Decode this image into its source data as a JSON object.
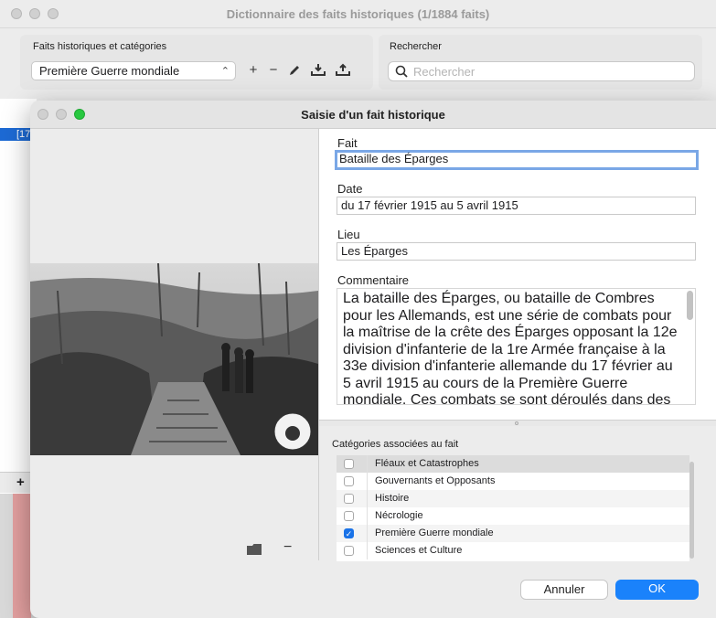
{
  "back_window": {
    "title": "Dictionnaire des faits historiques (1/1884 faits)",
    "group_label": "Faits historiques et catégories",
    "selected_category": "Première Guerre mondiale",
    "search_label": "Rechercher",
    "search_placeholder": "Rechercher",
    "list_fragment": "[17",
    "add_symbol": "+"
  },
  "dialog": {
    "title": "Saisie d'un fait historique",
    "fait_label": "Fait",
    "fait_value": "Bataille des Éparges",
    "date_label": "Date",
    "date_value": "du 17 février 1915 au 5 avril 1915",
    "lieu_label": "Lieu",
    "lieu_value": "Les Éparges",
    "commentaire_label": "Commentaire",
    "commentaire_value": "La bataille des Éparges, ou bataille de Combres pour les Allemands, est une série de combats pour la maîtrise de la crête des Éparges opposant la 12e division d'infanterie de la 1re Armée française à la 33e division d'infanterie allemande du 17 février au 5 avril 1915 au cours de la Première Guerre mondiale. Ces combats se sont déroulés dans des conditions",
    "categories_label": "Catégories associées au fait",
    "categories": [
      {
        "label": "Fléaux et Catastrophes",
        "checked": false
      },
      {
        "label": "Gouvernants et Opposants",
        "checked": false
      },
      {
        "label": "Histoire",
        "checked": false
      },
      {
        "label": "Nécrologie",
        "checked": false
      },
      {
        "label": "Première Guerre mondiale",
        "checked": true
      },
      {
        "label": "Sciences et Culture",
        "checked": false
      }
    ],
    "cancel_label": "Annuler",
    "ok_label": "OK",
    "remove_image_symbol": "−",
    "checkmark": "✓"
  },
  "colors": {
    "accent": "#1a82fb",
    "close": "#ff5f57",
    "minimize": "#febc2e",
    "zoom": "#28c840"
  },
  "icons": [
    "add-icon",
    "remove-icon",
    "pencil-icon",
    "import-icon",
    "export-icon",
    "search-icon",
    "folder-icon"
  ]
}
